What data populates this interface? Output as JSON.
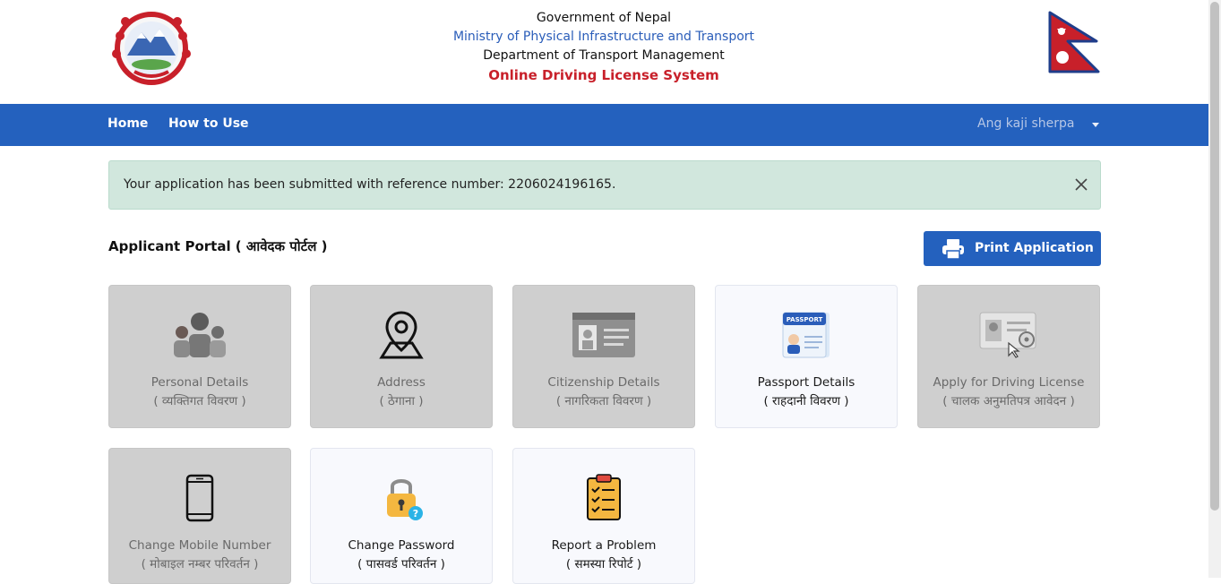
{
  "header": {
    "line1": "Government of Nepal",
    "line2": "Ministry of Physical Infrastructure and Transport",
    "line3": "Department of Transport Management",
    "line4": "Online Driving License System"
  },
  "nav": {
    "home": "Home",
    "how_to_use": "How to Use",
    "user": "Ang kaji sherpa"
  },
  "alert": {
    "message": "Your application has been submitted with reference number: 2206024196165."
  },
  "portal": {
    "title": "Applicant Portal ( आवेदक पोर्टल )",
    "print_label": "Print Application"
  },
  "cards": [
    {
      "title": "Personal Details",
      "sub": "( व्यक्तिगत विवरण )",
      "icon": "family-icon",
      "enabled": false
    },
    {
      "title": "Address",
      "sub": "( ठेगाना )",
      "icon": "location-pin-icon",
      "enabled": false
    },
    {
      "title": "Citizenship Details",
      "sub": "( नागरिकता विवरण )",
      "icon": "id-card-icon",
      "enabled": false
    },
    {
      "title": "Passport Details",
      "sub": "( राहदानी विवरण )",
      "icon": "passport-icon",
      "enabled": true
    },
    {
      "title": "Apply for Driving License",
      "sub": "( चालक अनुमतिपत्र आवेदन )",
      "icon": "driving-license-icon",
      "enabled": false
    },
    {
      "title": "Change Mobile Number",
      "sub": "( मोबाइल नम्बर परिवर्तन )",
      "icon": "mobile-phone-icon",
      "enabled": false
    },
    {
      "title": "Change Password",
      "sub": "( पासवर्ड परिवर्तन )",
      "icon": "padlock-icon",
      "enabled": true
    },
    {
      "title": "Report a Problem",
      "sub": "( समस्या रिपोर्ट )",
      "icon": "clipboard-checklist-icon",
      "enabled": true
    }
  ],
  "colors": {
    "navbar": "#2461be",
    "alert_bg": "#d1e7dd",
    "card_disabled": "#cfcfcf",
    "card_enabled": "#f8f9fd",
    "header_red": "#c8202a",
    "header_blue": "#2a5db9"
  }
}
